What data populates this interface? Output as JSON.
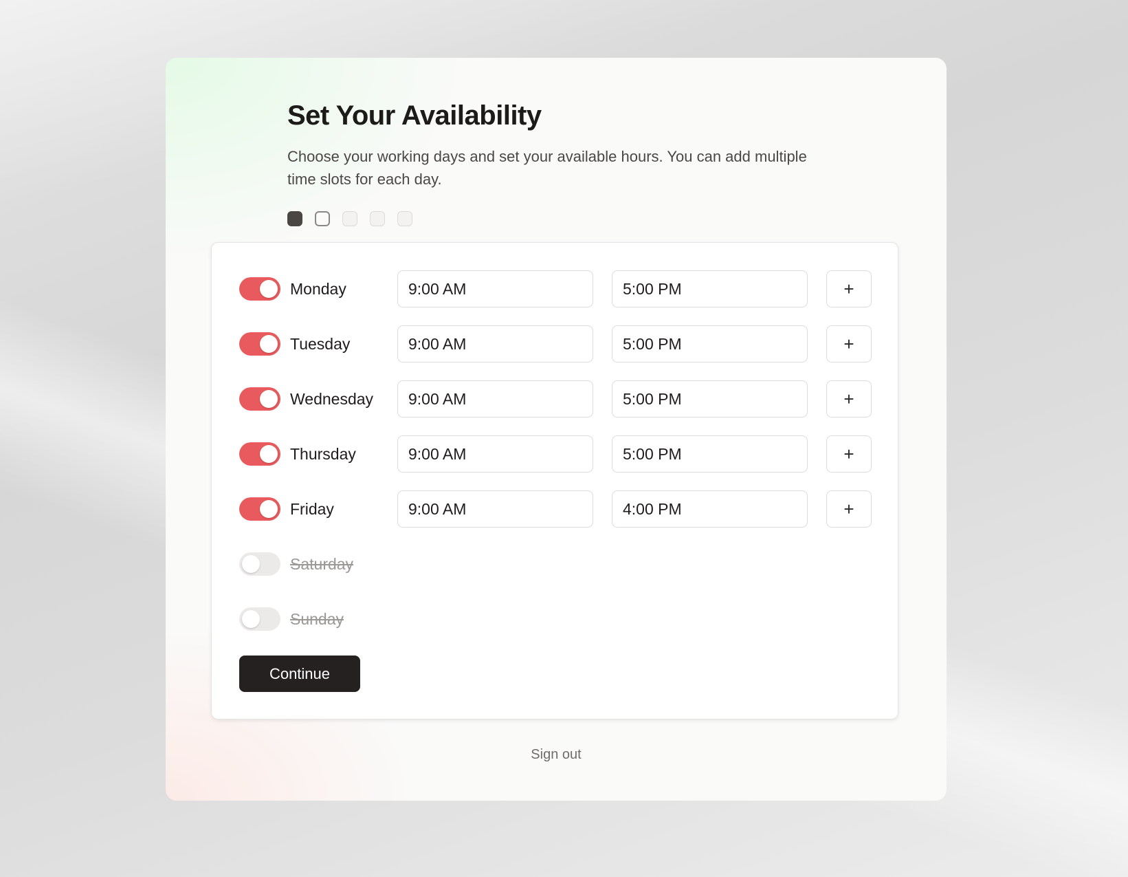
{
  "page": {
    "title": "Set Your Availability",
    "subtitle": "Choose your working days and set your available hours. You can add multiple time slots for each day.",
    "steps": {
      "total": 5,
      "current": 1
    }
  },
  "schedule": {
    "days": [
      {
        "name": "Monday",
        "enabled": true,
        "start": "9:00 AM",
        "end": "5:00 PM",
        "add_label": "+"
      },
      {
        "name": "Tuesday",
        "enabled": true,
        "start": "9:00 AM",
        "end": "5:00 PM",
        "add_label": "+"
      },
      {
        "name": "Wednesday",
        "enabled": true,
        "start": "9:00 AM",
        "end": "5:00 PM",
        "add_label": "+"
      },
      {
        "name": "Thursday",
        "enabled": true,
        "start": "9:00 AM",
        "end": "5:00 PM",
        "add_label": "+"
      },
      {
        "name": "Friday",
        "enabled": true,
        "start": "9:00 AM",
        "end": "4:00 PM",
        "add_label": "+"
      },
      {
        "name": "Saturday",
        "enabled": false
      },
      {
        "name": "Sunday",
        "enabled": false
      }
    ]
  },
  "actions": {
    "continue_label": "Continue",
    "signout_label": "Sign out"
  },
  "colors": {
    "toggle_on": "#e85a5d",
    "toggle_off": "#ebeae9",
    "primary_button": "#252120"
  }
}
